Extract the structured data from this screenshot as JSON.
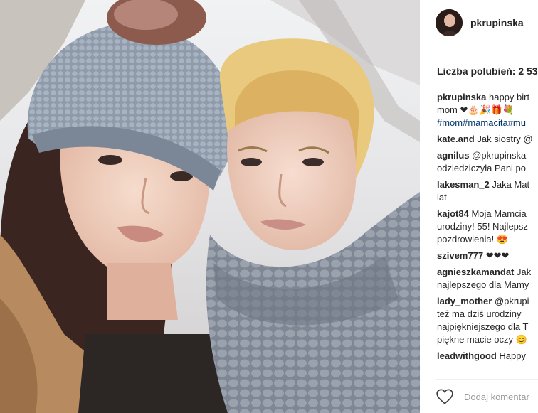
{
  "post": {
    "username": "pkrupinska",
    "likes_label": "Liczba polubień: 2 53",
    "add_comment_placeholder": "Dodaj komentar"
  },
  "comments": [
    {
      "user": "pkrupinska",
      "lines": [
        "happy birt",
        "mom ❤🎂🎉🎁💐"
      ],
      "hashtags": "#mom#mamacita#mu"
    },
    {
      "user": "kate.and",
      "lines": [
        "Jak siostry @"
      ]
    },
    {
      "user": "agnilus",
      "lines": [
        "@pkrupinska",
        "odziedziczyła Pani po"
      ]
    },
    {
      "user": "lakesman_2",
      "lines": [
        "Jaka Mat",
        "lat"
      ]
    },
    {
      "user": "kajot84",
      "lines": [
        "Moja Mamcia",
        "urodziny! 55! Najlepsz",
        "pozdrowienia! 😍"
      ]
    },
    {
      "user": "szivem777",
      "lines": [
        "❤❤❤"
      ]
    },
    {
      "user": "agnieszkamandat",
      "lines": [
        "Jak",
        "najlepszego dla Mamy"
      ]
    },
    {
      "user": "lady_mother",
      "lines": [
        "@pkrupi",
        "też ma dziś urodziny",
        "najpiękniejszego dla T",
        "piękne macie oczy 😊"
      ]
    },
    {
      "user": "leadwithgood",
      "lines": [
        "Happy"
      ]
    }
  ],
  "icons": {
    "like": "heart-outline-icon",
    "avatar": "profile-avatar"
  }
}
